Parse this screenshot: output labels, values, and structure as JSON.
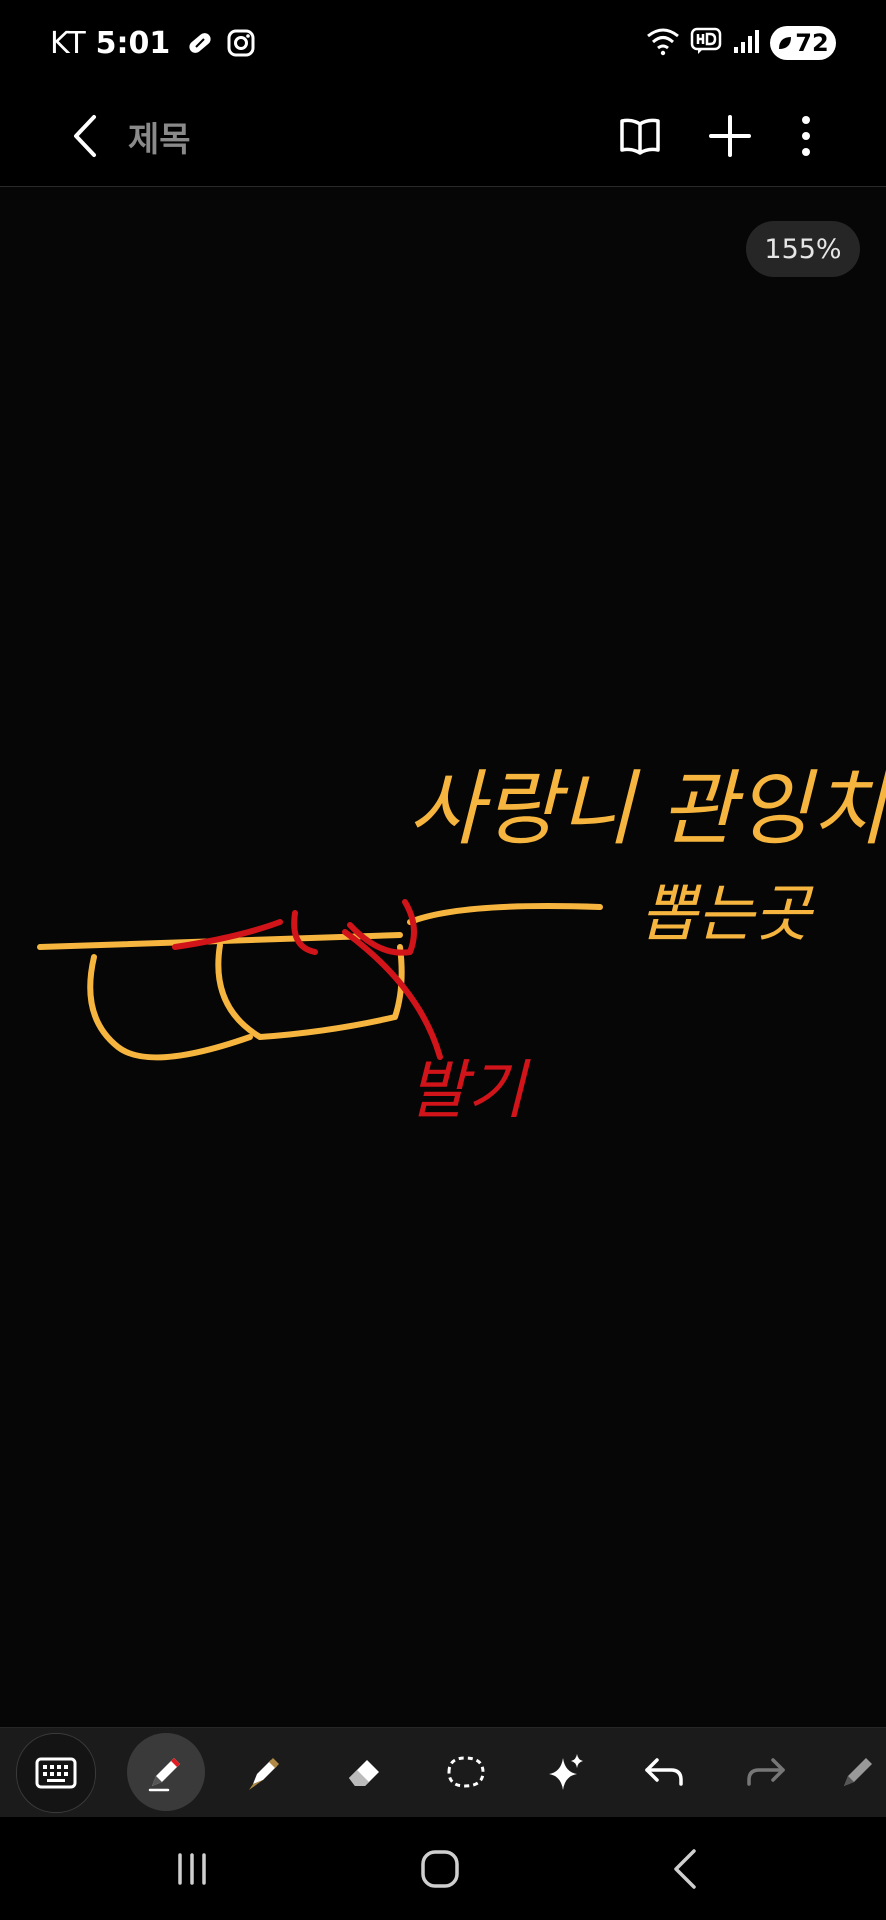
{
  "status_bar": {
    "carrier": "KT",
    "time": "5:01",
    "icons": [
      "pill-icon",
      "instagram-icon",
      "wifi-icon",
      "hd-voice-icon",
      "signal-icon"
    ],
    "battery": "72"
  },
  "app_bar": {
    "title": "제목",
    "actions": [
      "book-icon",
      "plus-icon",
      "more-vertical-icon"
    ]
  },
  "canvas": {
    "zoom": "155%",
    "colors": {
      "yellow_ink": "#f6b53e",
      "red_ink": "#d1141a",
      "background": "#060606"
    },
    "handwriting": [
      {
        "text": "사랑니 관잉치",
        "color": "yellow"
      },
      {
        "text": "뽑는곳",
        "color": "yellow"
      },
      {
        "text": "발기",
        "color": "red"
      }
    ]
  },
  "toolbar": {
    "tools": [
      "keyboard-icon",
      "pen-icon",
      "highlighter-icon",
      "eraser-icon",
      "lasso-icon",
      "sparkle-icon",
      "undo-icon",
      "redo-icon",
      "pencil-icon"
    ]
  },
  "nav_bar": {
    "buttons": [
      "recents-icon",
      "home-icon",
      "back-icon"
    ]
  }
}
